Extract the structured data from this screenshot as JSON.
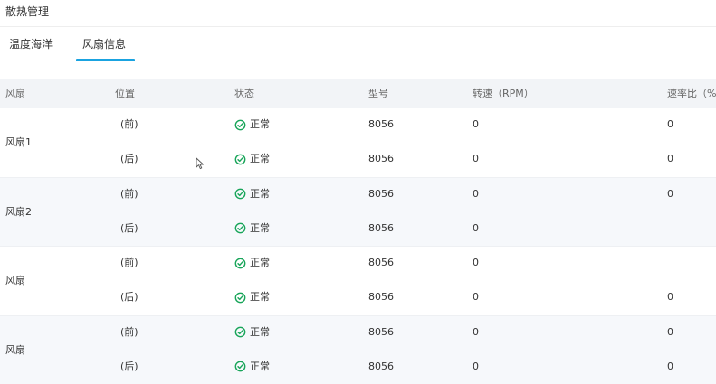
{
  "page": {
    "title": "散热管理"
  },
  "tabs": [
    {
      "label": "温度海洋",
      "active": false
    },
    {
      "label": "风扇信息",
      "active": true
    }
  ],
  "colors": {
    "accent": "#1aa3e0",
    "status_ok": "#19a55a",
    "header_bg": "#f2f4f7"
  },
  "table": {
    "headers": [
      "风扇",
      "位置",
      "状态",
      "型号",
      "转速（RPM）",
      "速率比（%"
    ],
    "groups": [
      {
        "name": "风扇1",
        "rows": [
          {
            "position": "(前)",
            "status": "正常",
            "status_icon": "check-circle-icon",
            "model": "8056",
            "speed": "0",
            "ratio": "0"
          },
          {
            "position": "(后)",
            "status": "正常",
            "status_icon": "check-circle-icon",
            "model": "8056",
            "speed": "0",
            "ratio": "0"
          }
        ]
      },
      {
        "name": "风扇2",
        "rows": [
          {
            "position": "(前)",
            "status": "正常",
            "status_icon": "check-circle-icon",
            "model": "8056",
            "speed": "0",
            "ratio": "0"
          },
          {
            "position": "(后)",
            "status": "正常",
            "status_icon": "check-circle-icon",
            "model": "8056",
            "speed": "0",
            "ratio": ""
          }
        ]
      },
      {
        "name": "风扇",
        "rows": [
          {
            "position": "(前)",
            "status": "正常",
            "status_icon": "check-circle-icon",
            "model": "8056",
            "speed": "0",
            "ratio": ""
          },
          {
            "position": "(后)",
            "status": "正常",
            "status_icon": "check-circle-icon",
            "model": "8056",
            "speed": "0",
            "ratio": "0"
          }
        ]
      },
      {
        "name": "风扇",
        "rows": [
          {
            "position": "(前)",
            "status": "正常",
            "status_icon": "check-circle-icon",
            "model": "8056",
            "speed": "0",
            "ratio": "0"
          },
          {
            "position": "(后)",
            "status": "正常",
            "status_icon": "check-circle-icon",
            "model": "8056",
            "speed": "0",
            "ratio": "0"
          }
        ]
      }
    ]
  }
}
